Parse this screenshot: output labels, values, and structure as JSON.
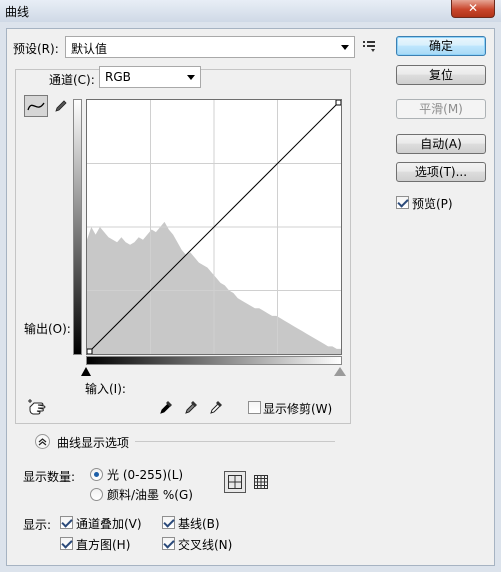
{
  "window": {
    "title": "曲线",
    "close_glyph": "✕"
  },
  "preset": {
    "label": "预设(R):",
    "value": "默认值",
    "menu_icon": "preset-menu-icon"
  },
  "channel": {
    "label": "通道(C):",
    "value": "RGB"
  },
  "buttons": {
    "ok": "确定",
    "reset": "复位",
    "smooth": "平滑(M)",
    "auto": "自动(A)",
    "options": "选项(T)..."
  },
  "preview": {
    "label": "预览(P)",
    "checked": true
  },
  "curve": {
    "output_label": "输出(O):",
    "input_label": "输入(I):",
    "points": [
      [
        0,
        0
      ],
      [
        255,
        255
      ]
    ],
    "histogram": [
      0.45,
      0.5,
      0.47,
      0.5,
      0.48,
      0.46,
      0.45,
      0.44,
      0.46,
      0.44,
      0.43,
      0.44,
      0.46,
      0.45,
      0.47,
      0.49,
      0.48,
      0.5,
      0.52,
      0.49,
      0.47,
      0.44,
      0.41,
      0.39,
      0.4,
      0.38,
      0.36,
      0.35,
      0.34,
      0.32,
      0.3,
      0.28,
      0.27,
      0.25,
      0.24,
      0.22,
      0.21,
      0.2,
      0.19,
      0.18,
      0.18,
      0.17,
      0.16,
      0.15,
      0.15,
      0.14,
      0.13,
      0.12,
      0.11,
      0.1,
      0.09,
      0.08,
      0.07,
      0.06,
      0.05,
      0.04,
      0.03,
      0.03,
      0.02,
      0.02
    ]
  },
  "show_clipping": {
    "label": "显示修剪(W)",
    "checked": false
  },
  "display_options": {
    "label": "曲线显示选项"
  },
  "show_amount": {
    "label": "显示数量:",
    "light": "光 (0-255)(L)",
    "pigment": "颜料/油墨 %(G)",
    "selected": "light"
  },
  "show": {
    "label": "显示:",
    "channel_overlay": {
      "label": "通道叠加(V)",
      "checked": true
    },
    "baseline": {
      "label": "基线(B)",
      "checked": true
    },
    "histogram": {
      "label": "直方图(H)",
      "checked": true
    },
    "intersection": {
      "label": "交叉线(N)",
      "checked": true
    }
  }
}
